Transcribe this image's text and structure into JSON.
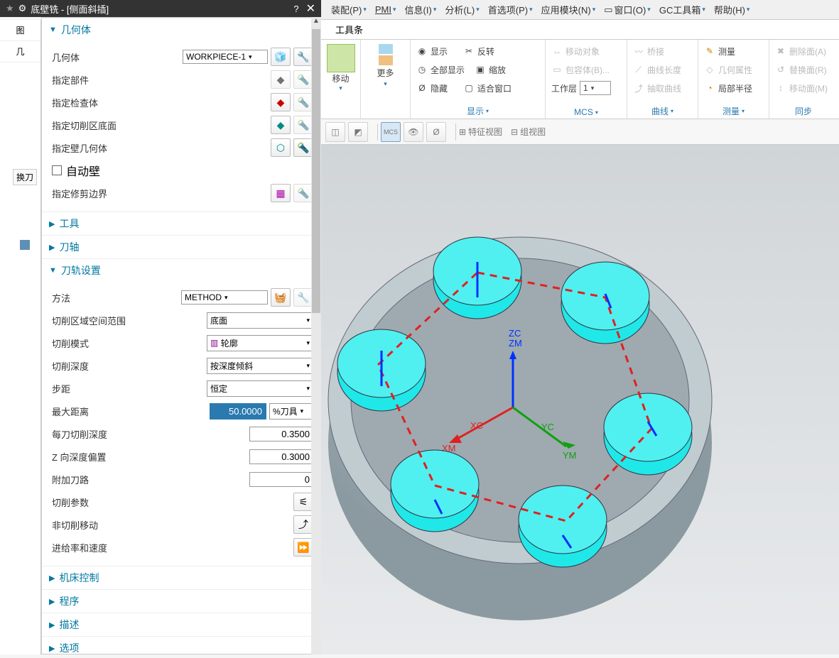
{
  "titlebar": {
    "title": "底壁铣 - [侧面斜插]",
    "help": "?",
    "close": "✕"
  },
  "ribbon": {
    "items": [
      "装配(P)",
      "PMI",
      "信息(I)",
      "分析(L)",
      "首选项(P)",
      "应用模块(N)",
      "窗口(O)",
      "GC工具箱",
      "帮助(H)"
    ]
  },
  "ribbon2": {
    "toolbar_label": "工具条"
  },
  "leftbar": {
    "tab1": "图",
    "tab2": "几",
    "swap": "换刀"
  },
  "tg_move": {
    "label": "移动",
    "more": "更多"
  },
  "tg_show": {
    "cap": "显示",
    "lines": [
      "显示",
      "全部显示",
      "隐藏",
      "反转",
      "缩放",
      "适合窗口"
    ]
  },
  "tg_mcs": {
    "cap": "MCS",
    "worklayer": "工作层",
    "worklayer_val": "1",
    "lines": [
      "移动对象",
      "包容体(B)...",
      "抽取曲线"
    ]
  },
  "tg_curve": {
    "cap": "曲线",
    "lines": [
      "桥接",
      "曲线长度",
      "抽取曲线"
    ]
  },
  "tg_measure": {
    "cap": "测量",
    "lines": [
      "测量",
      "几何属性",
      "局部半径"
    ]
  },
  "tg_sync": {
    "cap": "同步",
    "lines": [
      "删除面(A)",
      "替换面(R)",
      "移动面(M)"
    ]
  },
  "iconbar": {
    "feature": "特征视图",
    "group": "组视图"
  },
  "sections": {
    "geometry": {
      "title": "几何体",
      "geometry_label": "几何体",
      "geometry_value": "WORKPIECE-1",
      "part": "指定部件",
      "check": "指定检查体",
      "cutarea": "指定切削区底面",
      "wall": "指定壁几何体",
      "autowall": "自动壁",
      "trim": "指定修剪边界"
    },
    "tool": {
      "title": "工具"
    },
    "axis": {
      "title": "刀轴"
    },
    "path": {
      "title": "刀轨设置",
      "method_label": "方法",
      "method_value": "METHOD",
      "cutregion_label": "切削区域空间范围",
      "cutregion_value": "底面",
      "cutmode_label": "切削模式",
      "cutmode_value": "轮廓",
      "cutdepth_label": "切削深度",
      "cutdepth_value": "按深度倾斜",
      "step_label": "步距",
      "step_value": "恒定",
      "maxdist_label": "最大距离",
      "maxdist_value": "50.0000",
      "maxdist_unit": "%刀具",
      "depthpercut_label": "每刀切削深度",
      "depthpercut_value": "0.3500",
      "zoffset_label": "Z 向深度偏置",
      "zoffset_value": "0.3000",
      "addpath_label": "附加刀路",
      "addpath_value": "0",
      "cutparam": "切削参数",
      "noncut": "非切削移动",
      "feeds": "进给率和速度"
    },
    "machine": {
      "title": "机床控制"
    },
    "program": {
      "title": "程序"
    },
    "desc": {
      "title": "描述"
    },
    "options": {
      "title": "选项"
    }
  },
  "coords": {
    "zm": "ZM",
    "zc": "ZC",
    "xc": "XC",
    "xm": "XM",
    "yc": "YC",
    "ym": "YM"
  }
}
